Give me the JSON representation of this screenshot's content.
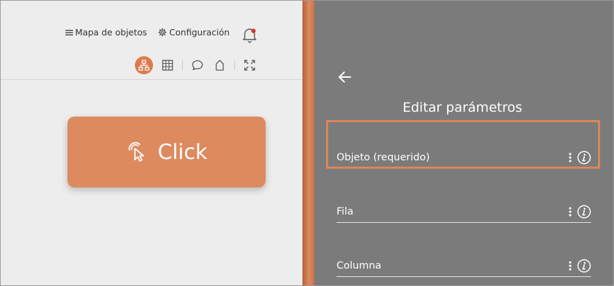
{
  "nav": {
    "objects_map_label": "Mapa de objetos",
    "settings_label": "Configuración"
  },
  "action_card": {
    "label": "Click",
    "color": "#dd8a5f"
  },
  "panel": {
    "title": "Editar parámetros",
    "params": [
      {
        "label": "Objeto (requerido)",
        "highlighted": true
      },
      {
        "label": "Fila"
      },
      {
        "label": "Columna"
      }
    ]
  },
  "colors": {
    "accent": "#dc7a4d",
    "panel_bg": "#7b7b7b",
    "left_bg": "#ededed"
  },
  "icons": [
    "hamburger-icon",
    "gear-icon",
    "bell-icon",
    "flow-diagram-icon",
    "table-grid-icon",
    "comment-icon",
    "tag-icon",
    "expand-icon",
    "cursor-click-icon",
    "back-arrow-icon",
    "kebab-icon",
    "info-icon"
  ]
}
